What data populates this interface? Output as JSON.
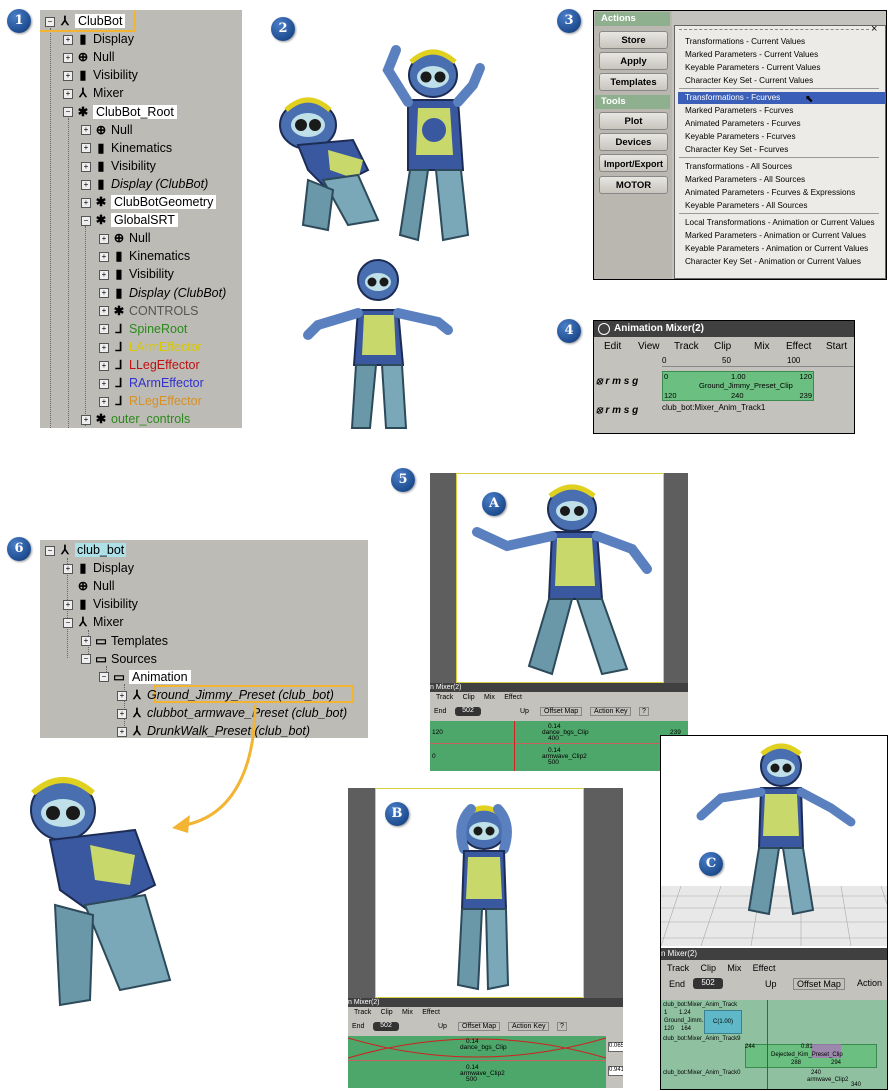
{
  "badges": {
    "b1": "1",
    "b2": "2",
    "b3": "3",
    "b4": "4",
    "b5": "5",
    "b6": "6",
    "A": "A",
    "B": "B",
    "C": "C"
  },
  "tree1": {
    "items": [
      {
        "label": "ClubBot",
        "color": "#000000"
      },
      {
        "label": "Display",
        "color": "#000000"
      },
      {
        "label": "Null",
        "color": "#000000"
      },
      {
        "label": "Visibility",
        "color": "#000000"
      },
      {
        "label": "Mixer",
        "color": "#000000"
      },
      {
        "label": "ClubBot_Root",
        "color": "#000000"
      },
      {
        "label": "Null",
        "color": "#000000"
      },
      {
        "label": "Kinematics",
        "color": "#000000"
      },
      {
        "label": "Visibility",
        "color": "#000000"
      },
      {
        "label": "Display (ClubBot)",
        "color": "#000000"
      },
      {
        "label": "ClubBotGeometry",
        "color": "#000000"
      },
      {
        "label": "GlobalSRT",
        "color": "#000000"
      },
      {
        "label": "Null",
        "color": "#000000"
      },
      {
        "label": "Kinematics",
        "color": "#000000"
      },
      {
        "label": "Visibility",
        "color": "#000000"
      },
      {
        "label": "Display (ClubBot)",
        "color": "#000000"
      },
      {
        "label": "CONTROLS",
        "color": "#555555"
      },
      {
        "label": "SpineRoot",
        "color": "#2a8a1a"
      },
      {
        "label": "LArmEffector",
        "color": "#d8c800"
      },
      {
        "label": "LLegEffector",
        "color": "#c01010"
      },
      {
        "label": "RArmEffector",
        "color": "#3030d0"
      },
      {
        "label": "RLegEffector",
        "color": "#d89020"
      },
      {
        "label": "outer_controls",
        "color": "#2a8a1a"
      }
    ]
  },
  "actions": {
    "header_actions": "Actions",
    "store": "Store",
    "apply": "Apply",
    "templates": "Templates",
    "header_tools": "Tools",
    "plot": "Plot",
    "devices": "Devices",
    "import_export": "Import/Export",
    "motor": "MOTOR",
    "menu": [
      "Transformations - Current Values",
      "Marked Parameters - Current Values",
      "Keyable Parameters - Current Values",
      "Character Key Set - Current Values",
      "Transformations - Fcurves",
      "Marked Parameters - Fcurves",
      "Animated Parameters - Fcurves",
      "Keyable Parameters - Fcurves",
      "Character Key Set - Fcurves",
      "Transformations - All Sources",
      "Marked Parameters - All Sources",
      "Animated Parameters - Fcurves & Expressions",
      "Keyable Parameters - All Sources",
      "Local Transformations - Animation or Current Values",
      "Marked Parameters - Animation or Current Values",
      "Keyable Parameters - Animation or Current Values",
      "Character Key Set - Animation or Current Values"
    ],
    "close": "×"
  },
  "mixer4": {
    "title": "Animation Mixer(2)",
    "menus": [
      "Edit",
      "View",
      "Track",
      "Clip",
      "Mix",
      "Effect",
      "Start"
    ],
    "ruler": [
      "0",
      "50",
      "100"
    ],
    "rmsg": "r m s g",
    "clip_top_left": "0",
    "clip_top_mid": "1.00",
    "clip_top_right": "120",
    "clip_name": "Ground_Jimmy_Preset_Clip",
    "clip_bot_left": "120",
    "clip_bot_mid": "240",
    "clip_bot_right": "239",
    "track2": "club_bot:Mixer_Anim_Track1"
  },
  "tree6": {
    "items": [
      {
        "label": "club_bot"
      },
      {
        "label": "Display"
      },
      {
        "label": "Null"
      },
      {
        "label": "Visibility"
      },
      {
        "label": "Mixer"
      },
      {
        "label": "Templates"
      },
      {
        "label": "Sources"
      },
      {
        "label": "Animation"
      },
      {
        "label": "Ground_Jimmy_Preset (club_bot)"
      },
      {
        "label": "clubbot_armwave_Preset (club_bot)"
      },
      {
        "label": "DrunkWalk_Preset (club_bot)"
      }
    ]
  },
  "shotA": {
    "title": "n Mixer(2)",
    "menus": [
      "Track",
      "Clip",
      "Mix",
      "Effect"
    ],
    "end_label": "End",
    "end_value": "502",
    "up": "Up",
    "offset": "Offset Map",
    "action_key": "Action Key",
    "help": "?",
    "ruler": [
      "100",
      "200",
      "300",
      "400"
    ],
    "clip1": "dance_bgs_Clip",
    "clip2": "armwave_Clip2",
    "v1": "0.14",
    "v2": "400",
    "v3": "0.14",
    "v4": "500",
    "l1": "120",
    "r1": "239",
    "l2": "0",
    "r2": "60"
  },
  "shotB": {
    "title": "n Mixer(2)",
    "menus": [
      "Track",
      "Clip",
      "Mix",
      "Effect"
    ],
    "end_label": "End",
    "end_value": "502",
    "up": "Up",
    "offset": "Offset Map",
    "action_key": "Action Key",
    "help": "?",
    "ruler": [
      "100",
      "200",
      "300",
      "400"
    ],
    "clip1": "dance_bgs_Clip",
    "clip2": "armwave_Clip2",
    "v1": "0.14",
    "v3": "0.14",
    "v4": "500",
    "w1": "0.065",
    "w2": "0.941"
  },
  "shotC": {
    "title": "n Mixer(2)",
    "menus": [
      "Track",
      "Clip",
      "Mix",
      "Effect"
    ],
    "end_label": "End",
    "end_value": "502",
    "up": "Up",
    "offset": "Offset Map",
    "action": "Action",
    "track1": "club_bot:Mixer_Anim_Track",
    "small1": "Ground_Jimm...",
    "c1": "C(1.00)",
    "clip_mid": "Dejected_Kim_Preset_Clip",
    "track2": "club_bot:Mixer_Anim_Track9",
    "track3": "club_bot:Mixer_Anim_Track0",
    "armwave": "armwave_Clip2",
    "n1": "1",
    "n2": "1.24",
    "n3": "120",
    "n4": "164",
    "n5": "244",
    "n6": "0.81",
    "n7": "288",
    "n8": "294",
    "n9": "240",
    "n10": "340"
  }
}
